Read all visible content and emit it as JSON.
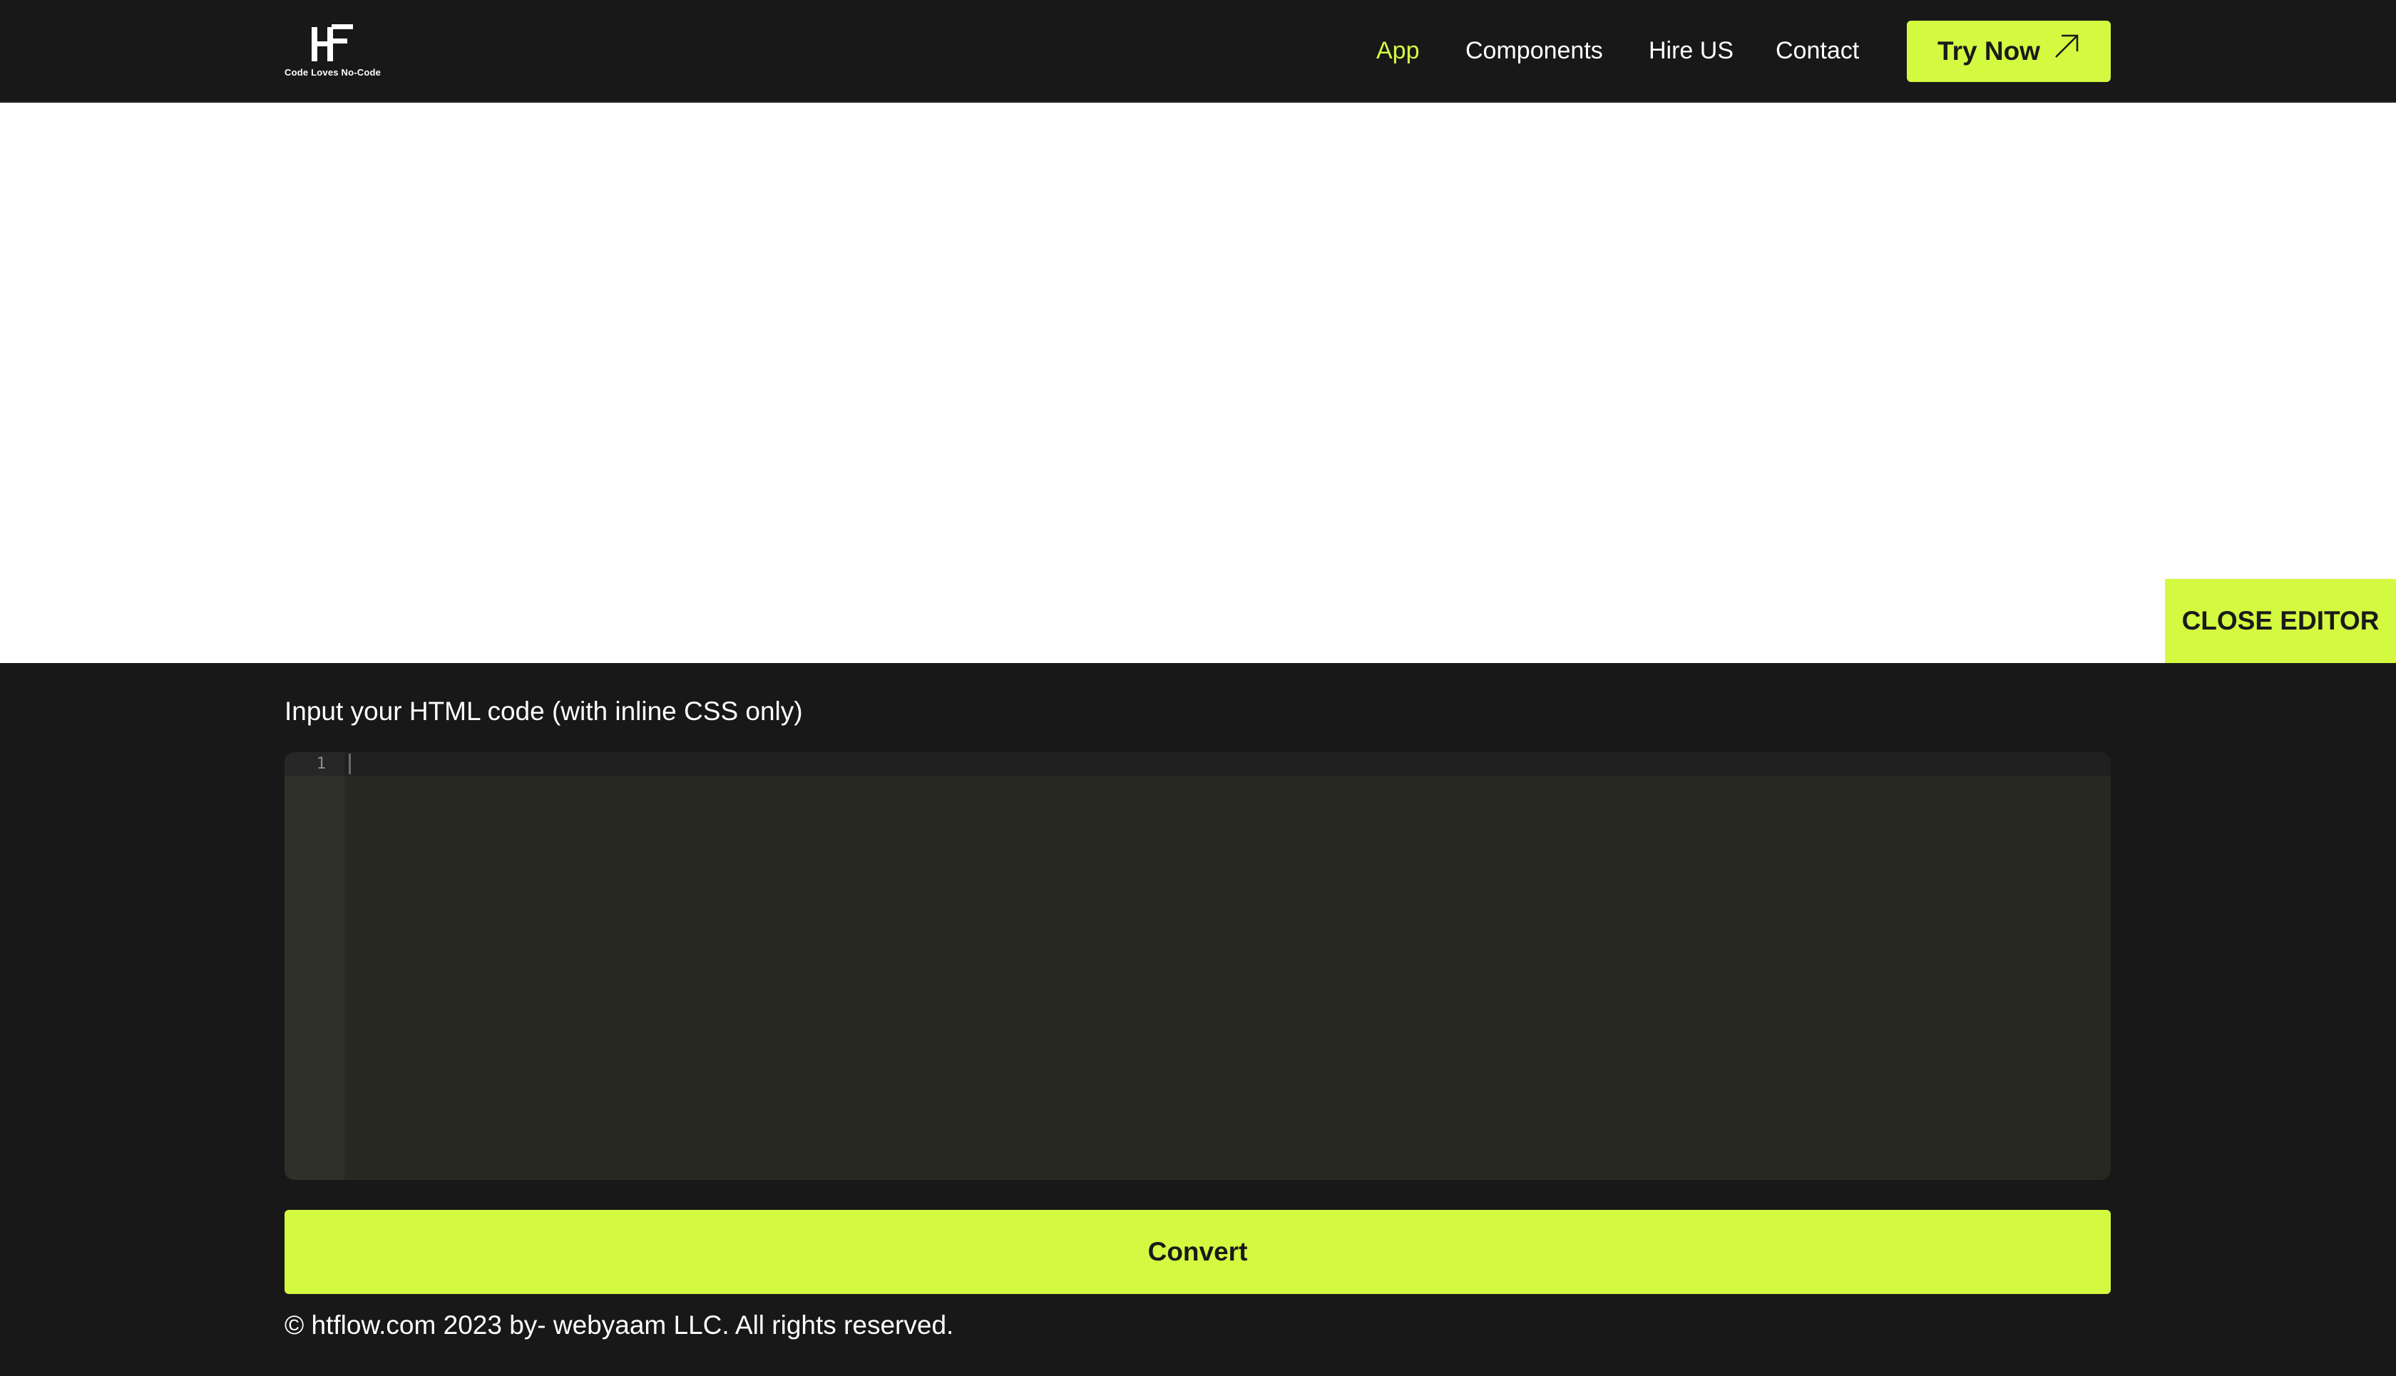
{
  "colors": {
    "background": "#181818",
    "accent": "#d4f941",
    "preview": "#ffffff",
    "editor": "#272822"
  },
  "header": {
    "logo": {
      "mark": "HF",
      "tagline": "Code Loves No-Code"
    },
    "nav": [
      {
        "label": "App",
        "active": true
      },
      {
        "label": "Components",
        "active": false
      },
      {
        "label": "Hire US",
        "active": false
      },
      {
        "label": "Contact",
        "active": false
      }
    ],
    "cta": {
      "label": "Try Now",
      "icon": "arrow-up-right-icon"
    }
  },
  "preview": {
    "close_label": "CLOSE EDITOR"
  },
  "editor": {
    "label": "Input your HTML code (with inline CSS only)",
    "line_numbers": [
      "1"
    ],
    "value": ""
  },
  "convert_label": "Convert",
  "footer": {
    "copyright": "© htflow.com 2023 by- webyaam LLC. All rights reserved."
  }
}
